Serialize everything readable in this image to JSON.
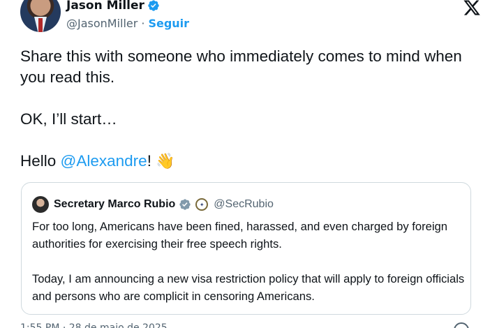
{
  "author": {
    "name": "Jason Miller",
    "handle": "@JasonMiller",
    "separator": "·",
    "follow_label": "Seguir"
  },
  "tweet": {
    "line1": "Share this with someone who immediately comes to mind when you read this.",
    "line2": "OK, I’ll start…",
    "greeting": "Hello ",
    "mention": "@Alexandre",
    "after_mention": "!",
    "emoji": "👋"
  },
  "quote": {
    "name": "Secretary Marco Rubio",
    "handle": "@SecRubio",
    "para1": "For too long, Americans have been fined, harassed, and even charged by foreign authorities for exercising their free speech rights.",
    "para2": "Today, I am announcing a new visa restriction policy that will apply to foreign officials and persons who are complicit in censoring Americans."
  },
  "footer": {
    "timestamp_partial": "1:55 PM · 28 de maio de 2025"
  },
  "colors": {
    "accent": "#1d9bf0",
    "text": "#0f1419",
    "muted": "#536471",
    "border": "#cfd9de",
    "verified_gray": "#829aab"
  },
  "icons": [
    "verified-badge-icon",
    "x-logo-icon",
    "wave-emoji-icon",
    "state-dept-seal-icon",
    "info-icon"
  ]
}
